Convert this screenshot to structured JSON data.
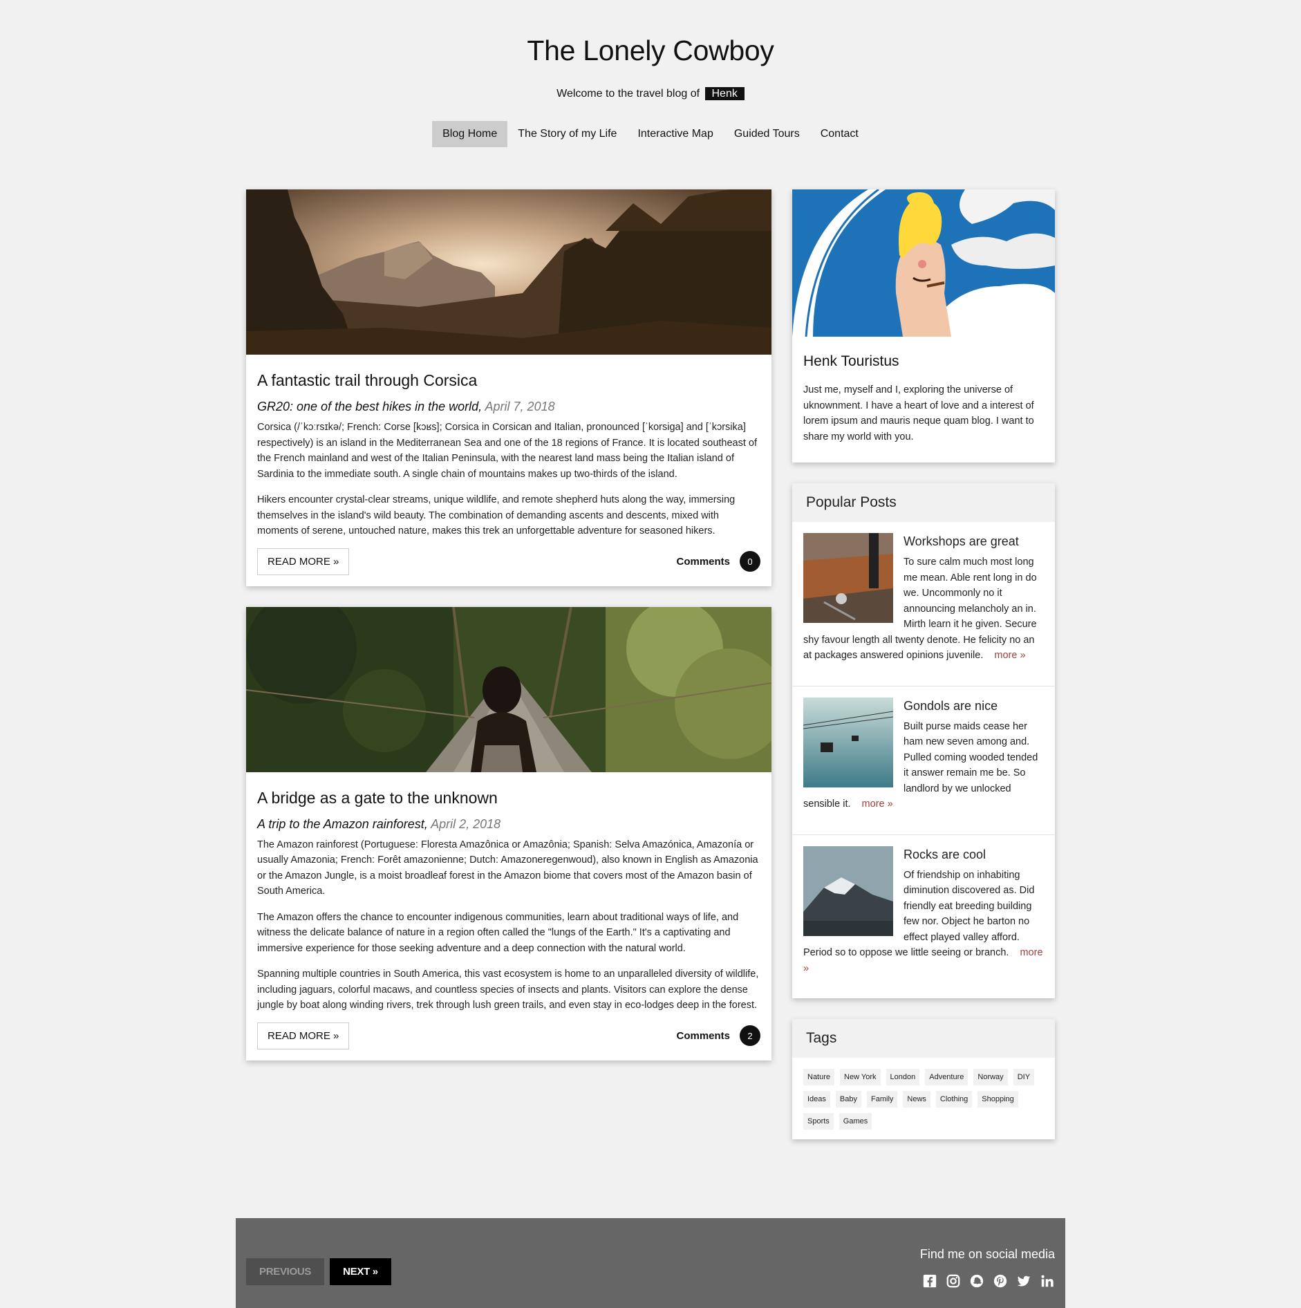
{
  "header": {
    "title": "The Lonely Cowboy",
    "tagline": "Welcome to the travel blog of",
    "name_tag": "Henk"
  },
  "nav": {
    "items": [
      "Blog Home",
      "The Story of my Life",
      "Interactive Map",
      "Guided Tours",
      "Contact"
    ],
    "active": "Blog Home"
  },
  "posts": [
    {
      "title": "A fantastic trail through Corsica",
      "subtitle": "GR20: one of the best hikes in the world,",
      "date": "April 7, 2018",
      "paragraphs": [
        "Corsica (/ˈkɔːrsɪkə/; French: Corse [kɔʁs]; Corsica in Corsican and Italian, pronounced [ˈkorsiga] and [ˈkɔrsika] respectively) is an island in the Mediterranean Sea and one of the 18 regions of France. It is located southeast of the French mainland and west of the Italian Peninsula, with the nearest land mass being the Italian island of Sardinia to the immediate south. A single chain of mountains makes up two-thirds of the island.",
        "Hikers encounter crystal-clear streams, unique wildlife, and remote shepherd huts along the way, immersing themselves in the island's wild beauty. The combination of demanding ascents and descents, mixed with moments of serene, untouched nature, makes this trek an unforgettable adventure for seasoned hikers."
      ],
      "read_more": "READ MORE »",
      "comments_label": "Comments",
      "comments_count": "0"
    },
    {
      "title": "A bridge as a gate to the unknown",
      "subtitle": "A trip to the Amazon rainforest,",
      "date": "April 2, 2018",
      "paragraphs": [
        "The Amazon rainforest (Portuguese: Floresta Amazônica or Amazônia; Spanish: Selva Amazónica, Amazonía or usually Amazonia; French: Forêt amazonienne; Dutch: Amazoneregenwoud), also known in English as Amazonia or the Amazon Jungle, is a moist broadleaf forest in the Amazon biome that covers most of the Amazon basin of South America.",
        "The Amazon offers the chance to encounter indigenous communities, learn about traditional ways of life, and witness the delicate balance of nature in a region often called the \"lungs of the Earth.\" It's a captivating and immersive experience for those seeking adventure and a deep connection with the natural world.",
        "Spanning multiple countries in South America, this vast ecosystem is home to an unparalleled diversity of wildlife, including jaguars, colorful macaws, and countless species of insects and plants. Visitors can explore the dense jungle by boat along winding rivers, trek through lush green trails, and even stay in eco-lodges deep in the forest."
      ],
      "read_more": "READ MORE »",
      "comments_label": "Comments",
      "comments_count": "2"
    }
  ],
  "about": {
    "name": "Henk Touristus",
    "text": "Just me, myself and I, exploring the universe of uknownment. I have a heart of love and a interest of lorem ipsum and mauris neque quam blog. I want to share my world with you."
  },
  "popular": {
    "heading": "Popular Posts",
    "items": [
      {
        "title": "Workshops are great",
        "text": "To sure calm much most long me mean. Able rent long in do we. Uncommonly no it announcing melancholy an in. Mirth learn it he given. Secure shy favour length all twenty denote. He felicity no an at packages answered opinions juvenile.",
        "more": "more »"
      },
      {
        "title": "Gondols are nice",
        "text": "Built purse maids cease her ham new seven among and. Pulled coming wooded tended it answer remain me be. So landlord by we unlocked sensible it.",
        "more": "more »"
      },
      {
        "title": "Rocks are cool",
        "text": "Of friendship on inhabiting diminution discovered as. Did friendly eat breeding building few nor. Object he barton no effect played valley afford. Period so to oppose we little seeing or branch.",
        "more": "more »"
      }
    ]
  },
  "tags": {
    "heading": "Tags",
    "items": [
      "Nature",
      "New York",
      "London",
      "Adventure",
      "Norway",
      "DIY",
      "Ideas",
      "Baby",
      "Family",
      "News",
      "Clothing",
      "Shopping",
      "Sports",
      "Games"
    ]
  },
  "footer": {
    "prev": "PREVIOUS",
    "next": "NEXT »",
    "social_title": "Find me on social media",
    "social_icons": [
      "facebook-icon",
      "instagram-icon",
      "snapchat-icon",
      "pinterest-icon",
      "twitter-icon",
      "linkedin-icon"
    ]
  },
  "colors": {
    "background": "#f1f1f1",
    "nav_active": "#cccccc",
    "badge": "#111111",
    "more_link": "#a0403a",
    "footer": "#666666"
  }
}
